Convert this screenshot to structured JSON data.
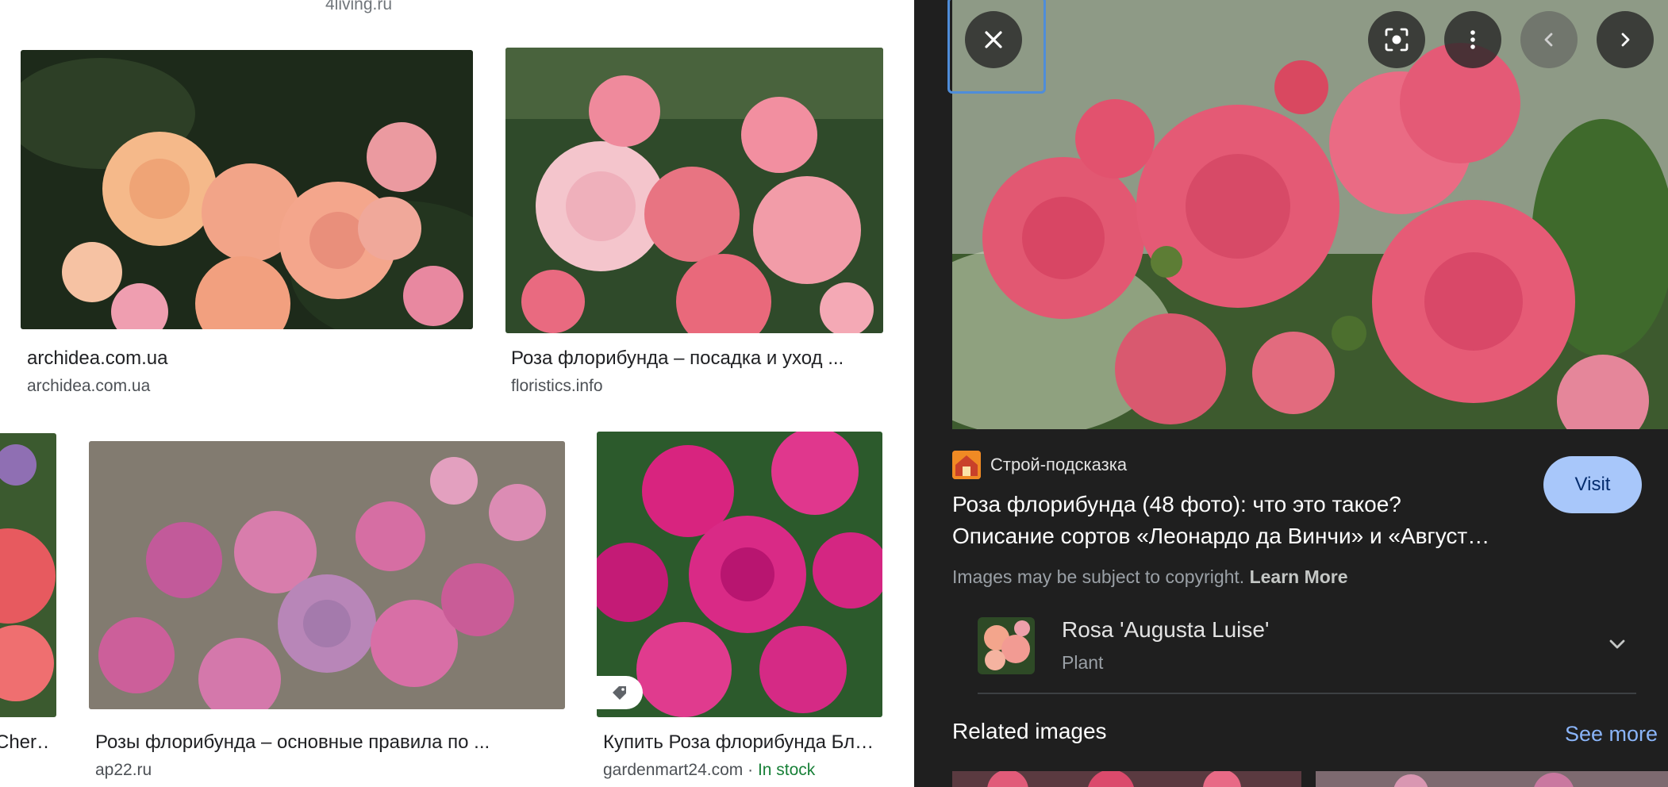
{
  "left_grid": {
    "top_site": "4living.ru",
    "results": [
      {
        "title": "archidea.com.ua",
        "site": "archidea.com.ua"
      },
      {
        "title": "Роза флорибунда – посадка и уход ...",
        "site": "floristics.info"
      },
      {
        "title": "Cher…",
        "site": ""
      },
      {
        "title": "Розы флорибунда – основные правила по ...",
        "site": "ap22.ru"
      },
      {
        "title": "Купить Роза флорибунда Бл…",
        "site": "gardenmart24.com",
        "separator": " · ",
        "stock": "In stock"
      }
    ]
  },
  "panel": {
    "controls": [
      "close-icon",
      "lens-icon",
      "more-vert-icon",
      "chevron-left-icon",
      "chevron-right-icon"
    ],
    "source_name": "Строй-подсказка",
    "title_line1": "Роза флорибунда (48 фото): что это такое?",
    "title_line2": "Описание сортов «Леонардо да Винчи» и «Август…",
    "visit_label": "Visit",
    "copyright_text": "Images may be subject to copyright.",
    "learn_more": "Learn More",
    "entity": {
      "name": "Rosa 'Augusta Luise'",
      "type": "Plant"
    },
    "related_title": "Related images",
    "see_more": "See more"
  },
  "colors": {
    "panel_bg": "#1f1f1f",
    "visit_bg": "#a8c7fa",
    "link": "#8ab4f8",
    "in_stock": "#188038"
  }
}
